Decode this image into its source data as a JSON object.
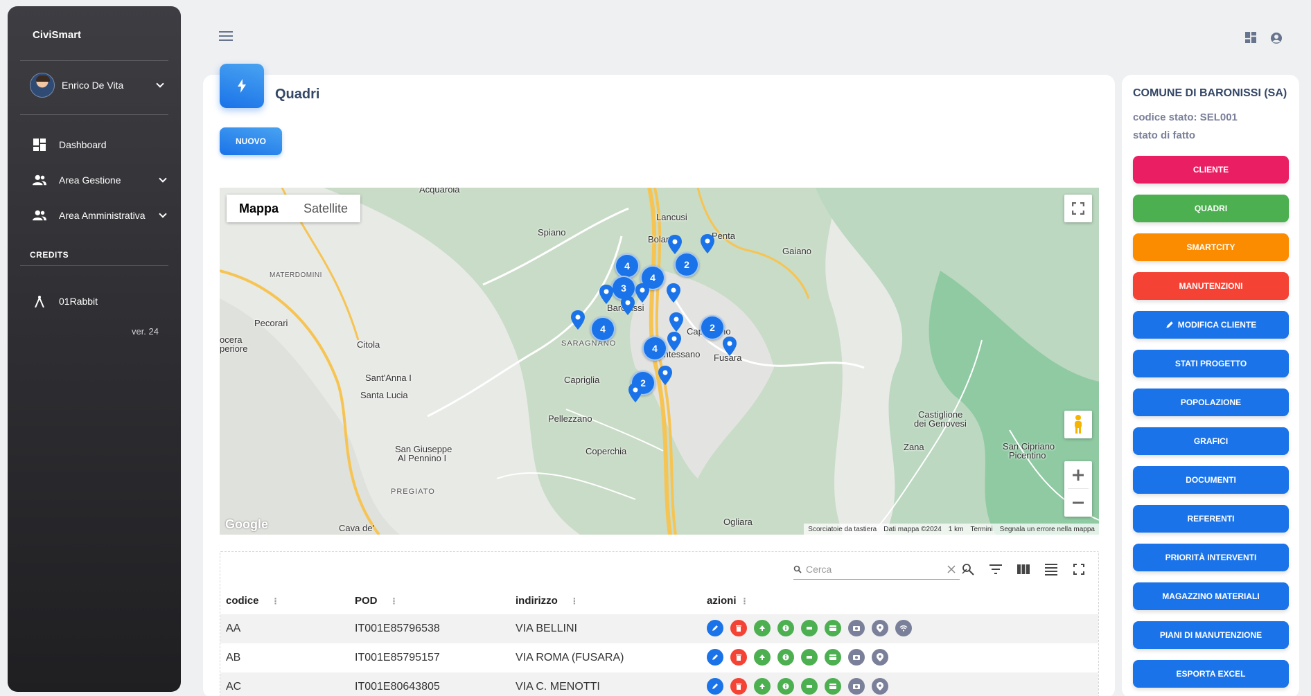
{
  "app": {
    "brand": "CiviSmart",
    "version": "ver. 24"
  },
  "sidebar": {
    "user": "Enrico De Vita",
    "items": [
      {
        "label": "Dashboard",
        "icon": "dashboard-icon"
      },
      {
        "label": "Area Gestione",
        "icon": "users-icon"
      },
      {
        "label": "Area Amministrativa",
        "icon": "users-icon"
      }
    ],
    "credits_heading": "CREDITS",
    "credits_item": "01Rabbit"
  },
  "page": {
    "title": "Quadri",
    "new_button": "NUOVO"
  },
  "map": {
    "type_buttons": [
      "Mappa",
      "Satellite"
    ],
    "places": [
      "Acquarola",
      "Lancusi",
      "Bolano",
      "Penta",
      "Gaiano",
      "Spiano",
      "Baronissi",
      "Pecorari",
      "Citola",
      "SARAGNANO",
      "Caprecano",
      "Fusara",
      "Antessano",
      "Capriglia",
      "Sant'Anna I",
      "Santa Lucia",
      "Pellezzano",
      "Coperchia",
      "San Giuseppe",
      "Al Pennino I",
      "PREGIATO",
      "Cava de'",
      "Ogliara",
      "Castiglione",
      "dei Genovesi",
      "Zana",
      "San Cipriano",
      "Picentino",
      "MATERDOMINI",
      "ocera",
      "periore"
    ],
    "clusters": [
      "4",
      "4",
      "2",
      "3",
      "4",
      "2",
      "4",
      "2"
    ],
    "footer": [
      "Scorciatoie da tastiera",
      "Dati mappa ©2024",
      "1 km",
      "Termini",
      "Segnala un errore nella mappa"
    ],
    "google": "Google"
  },
  "table": {
    "search_placeholder": "Cerca",
    "headers": [
      "codice",
      "POD",
      "indirizzo",
      "azioni"
    ],
    "rows": [
      {
        "codice": "AA",
        "pod": "IT001E85796538",
        "indirizzo": "VIA BELLINI"
      },
      {
        "codice": "AB",
        "pod": "IT001E85795157",
        "indirizzo": "VIA ROMA (FUSARA)"
      },
      {
        "codice": "AC",
        "pod": "IT001E80643805",
        "indirizzo": "VIA C. MENOTTI"
      }
    ]
  },
  "panel": {
    "title": "COMUNE DI BARONISSI (SA)",
    "status_code": "codice stato: SEL001",
    "status_label": "stato di fatto",
    "buttons": [
      {
        "label": "CLIENTE",
        "color": "#e91e63"
      },
      {
        "label": "QUADRI",
        "color": "#4caf50"
      },
      {
        "label": "SMARTCITY",
        "color": "#fb8c00"
      },
      {
        "label": "MANUTENZIONI",
        "color": "#f44335"
      },
      {
        "label": "MODIFICA CLIENTE",
        "color": "#1a73e8"
      },
      {
        "label": "STATI PROGETTO",
        "color": "#1a73e8"
      },
      {
        "label": "POPOLAZIONE",
        "color": "#1a73e8"
      },
      {
        "label": "GRAFICI",
        "color": "#1a73e8"
      },
      {
        "label": "DOCUMENTI",
        "color": "#1a73e8"
      },
      {
        "label": "REFERENTI",
        "color": "#1a73e8"
      },
      {
        "label": "PRIORITÀ INTERVENTI",
        "color": "#1a73e8"
      },
      {
        "label": "MAGAZZINO MATERIALI",
        "color": "#1a73e8"
      },
      {
        "label": "PIANI DI MANUTENZIONE",
        "color": "#1a73e8"
      },
      {
        "label": "ESPORTA EXCEL",
        "color": "#1a73e8"
      }
    ]
  }
}
